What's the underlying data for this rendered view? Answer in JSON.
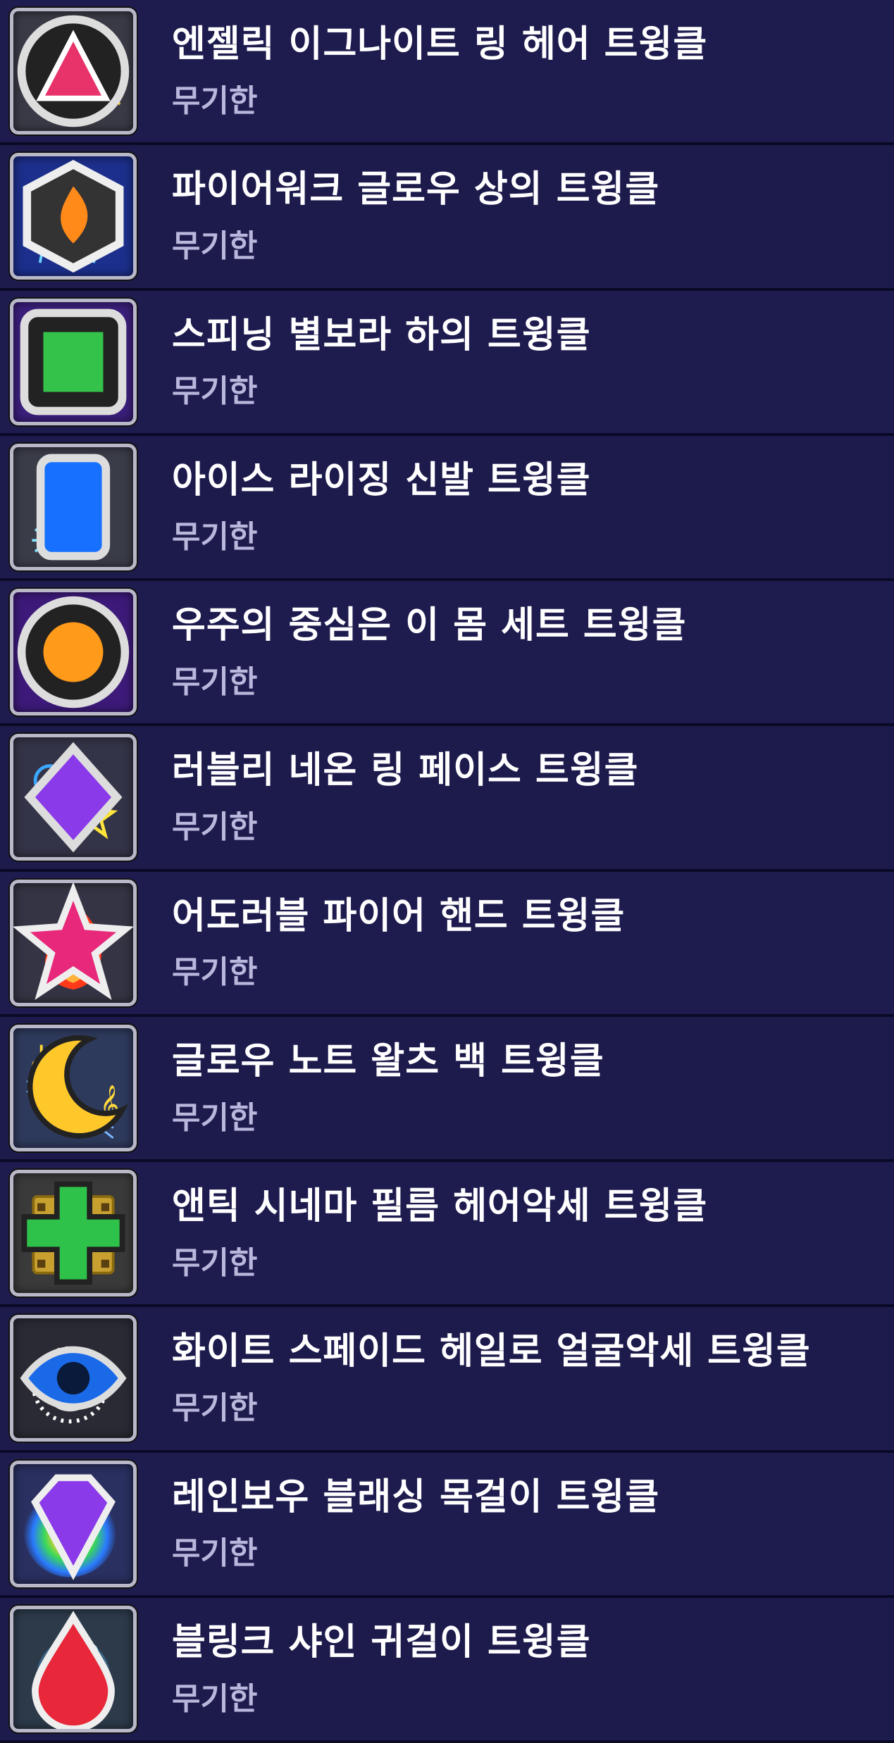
{
  "items": [
    {
      "name": "엔젤릭 이그나이트 링 헤어 트윙클",
      "duration": "무기한",
      "icon": "golden-sparkle-hair-icon",
      "badge": "triangle-gem-badge-icon"
    },
    {
      "name": "파이어워크 글로우 상의 트윙클",
      "duration": "무기한",
      "icon": "blue-firework-icon",
      "badge": "hexagon-fire-badge-icon"
    },
    {
      "name": "스피닝 별보라 하의 트윙클",
      "duration": "무기한",
      "icon": "purple-star-swirl-icon",
      "badge": "green-square-badge-icon"
    },
    {
      "name": "아이스 라이징 신발 트윙클",
      "duration": "무기한",
      "icon": "snowflake-mist-icon",
      "badge": "blue-card-badge-icon"
    },
    {
      "name": "우주의 중심은 이 몸 세트 트윙클",
      "duration": "무기한",
      "icon": "galaxy-planet-icon",
      "badge": "orange-orb-badge-icon"
    },
    {
      "name": "러블리 네온 링 페이스 트윙클",
      "duration": "무기한",
      "icon": "neon-ring-stars-icon",
      "badge": "purple-diamond-badge-icon"
    },
    {
      "name": "어도러블 파이어 핸드 트윙클",
      "duration": "무기한",
      "icon": "fire-flame-icon",
      "badge": "pink-star-badge-icon"
    },
    {
      "name": "글로우 노트 왈츠 백 트윙클",
      "duration": "무기한",
      "icon": "glowing-music-notes-icon",
      "badge": "crescent-moon-badge-icon"
    },
    {
      "name": "앤틱 시네마 필름 헤어악세 트윙클",
      "duration": "무기한",
      "icon": "film-reel-icon",
      "badge": "green-clover-badge-icon"
    },
    {
      "name": "화이트 스페이드 헤일로 얼굴악세 트윙클",
      "duration": "무기한",
      "icon": "white-halo-ring-icon",
      "badge": "blue-eye-badge-icon"
    },
    {
      "name": "레인보우 블래싱 목걸이 트윙클",
      "duration": "무기한",
      "icon": "rainbow-glow-icon",
      "badge": "purple-gem-badge-icon"
    },
    {
      "name": "블링크 샤인 귀걸이 트윙클",
      "duration": "무기한",
      "icon": "blue-atom-swirl-icon",
      "badge": "red-drop-badge-icon"
    }
  ]
}
